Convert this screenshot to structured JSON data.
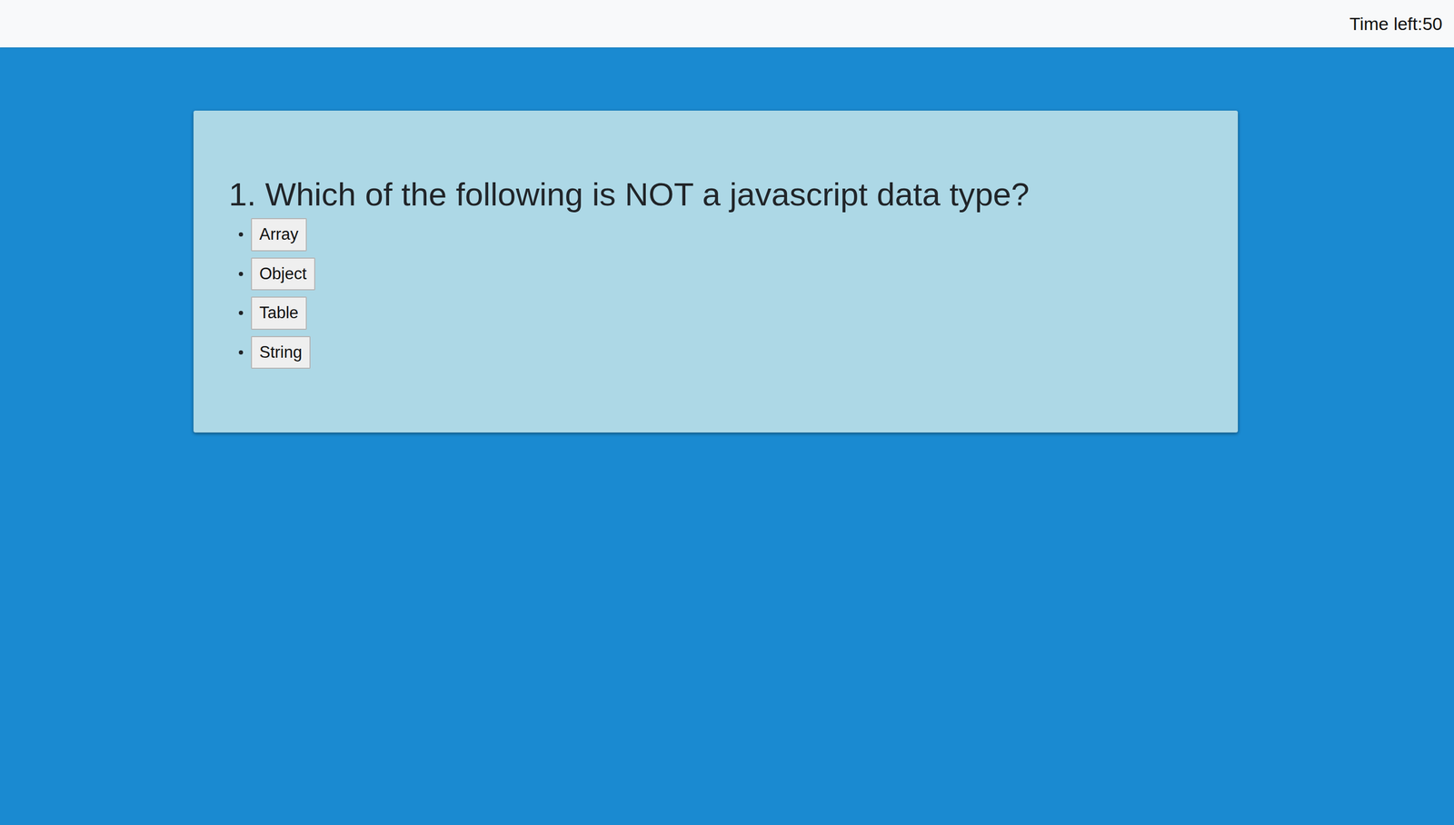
{
  "header": {
    "timer": "Time left:50"
  },
  "question": {
    "title": "1. Which of the following is NOT a javascript data type?",
    "options": [
      {
        "label": "Array"
      },
      {
        "label": "Object"
      },
      {
        "label": "Table"
      },
      {
        "label": "String"
      }
    ]
  }
}
